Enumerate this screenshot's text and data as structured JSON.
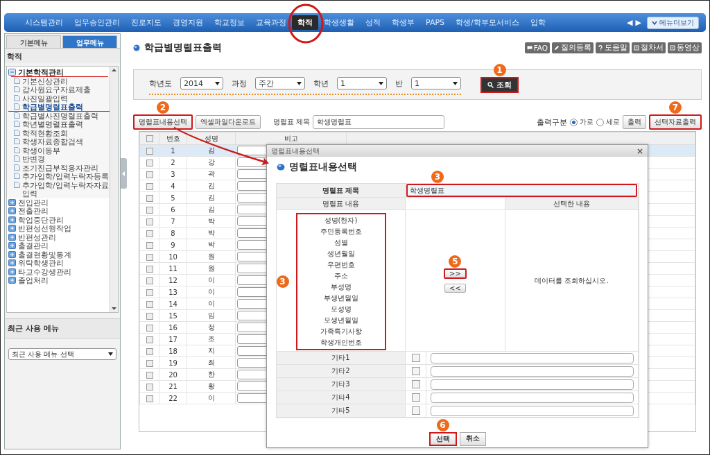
{
  "nav": {
    "items": [
      {
        "label": "시스템관리",
        "selected": false,
        "circled": false
      },
      {
        "label": "업무승인관리",
        "selected": false,
        "circled": false
      },
      {
        "label": "진로지도",
        "selected": false,
        "circled": false
      },
      {
        "label": "경영지원",
        "selected": false,
        "circled": false
      },
      {
        "label": "학교정보",
        "selected": false,
        "circled": false
      },
      {
        "label": "교육과정",
        "selected": false,
        "circled": false
      },
      {
        "label": "학적",
        "selected": true,
        "circled": true
      },
      {
        "label": "학생생활",
        "selected": false,
        "circled": false
      },
      {
        "label": "성적",
        "selected": false,
        "circled": false
      },
      {
        "label": "학생부",
        "selected": false,
        "circled": false
      },
      {
        "label": "PAPS",
        "selected": false,
        "circled": false
      },
      {
        "label": "학생/학부모서비스",
        "selected": false,
        "circled": false
      },
      {
        "label": "입학",
        "selected": false,
        "circled": false
      }
    ],
    "prev": "◀",
    "next": "▶",
    "more_button": "메뉴더보기"
  },
  "sidebar": {
    "tabs": [
      {
        "label": "기본메뉴",
        "selected": false
      },
      {
        "label": "업무메뉴",
        "selected": true
      }
    ],
    "heading": "학적",
    "tree": [
      {
        "label": "기본학적관리",
        "expanded": true,
        "underlined": true,
        "children": [
          {
            "label": "기본신상관리",
            "selected": false,
            "underlined": false
          },
          {
            "label": "감사원요구자료제출",
            "selected": false,
            "underlined": false
          },
          {
            "label": "사진일괄입력",
            "selected": false,
            "underlined": false
          },
          {
            "label": "학급별명렬표출력",
            "selected": true,
            "underlined": true
          },
          {
            "label": "학급별사진명렬표출력",
            "selected": false,
            "underlined": false
          },
          {
            "label": "학년별명렬표출력",
            "selected": false,
            "underlined": false
          },
          {
            "label": "학적현황조회",
            "selected": false,
            "underlined": false
          },
          {
            "label": "학생자료종합검색",
            "selected": false,
            "underlined": false
          },
          {
            "label": "학생이동부",
            "selected": false,
            "underlined": false
          },
          {
            "label": "반변경",
            "selected": false,
            "underlined": false
          },
          {
            "label": "조기진급부적응자관리",
            "selected": false,
            "underlined": false
          },
          {
            "label": "추가입학/입력누락자등록",
            "selected": false,
            "underlined": false
          },
          {
            "label": "추가입학/입력누락자자료입력",
            "selected": false,
            "underlined": false
          }
        ]
      },
      {
        "label": "전입관리",
        "expanded": false,
        "underlined": false
      },
      {
        "label": "전출관리",
        "expanded": false,
        "underlined": false
      },
      {
        "label": "학업중단관리",
        "expanded": false,
        "underlined": false
      },
      {
        "label": "반편성선행작업",
        "expanded": false,
        "underlined": false
      },
      {
        "label": "반편성관리",
        "expanded": false,
        "underlined": false
      },
      {
        "label": "출결관리",
        "expanded": false,
        "underlined": false
      },
      {
        "label": "출결현황및통계",
        "expanded": false,
        "underlined": false
      },
      {
        "label": "위탁학생관리",
        "expanded": false,
        "underlined": false
      },
      {
        "label": "타교수강생관리",
        "expanded": false,
        "underlined": false
      },
      {
        "label": "졸업처리",
        "expanded": false,
        "underlined": false
      }
    ],
    "recent_heading": "최근 사용 메뉴",
    "recent_select": "최근 사용 메뉴 선택"
  },
  "page": {
    "title": "학급별명렬표출력",
    "help_buttons": [
      {
        "kind": "faq",
        "label": "FAQ"
      },
      {
        "kind": "pencil",
        "label": "질의등록"
      },
      {
        "kind": "question",
        "label": "도움말"
      },
      {
        "kind": "doc",
        "label": "절차서"
      },
      {
        "kind": "doc",
        "label": "동영상"
      }
    ]
  },
  "filters": {
    "fields": [
      {
        "label": "학년도",
        "value": "2014"
      },
      {
        "label": "과정",
        "value": "주간"
      },
      {
        "label": "학년",
        "value": "1"
      },
      {
        "label": "반",
        "value": "1"
      }
    ],
    "search_button": {
      "label": "조회",
      "highlighted": true,
      "badge": "1"
    }
  },
  "toolbar": {
    "content_button": {
      "label": "명렬표내용선택",
      "highlighted": true,
      "badge": "2"
    },
    "excel_button": {
      "label": "엑셀파일다운로드",
      "highlighted": false
    },
    "title_label": "명렬표 제목",
    "title_value": "학생명렬표",
    "output_label": "출력구분",
    "output_options": [
      {
        "label": "가로",
        "selected": true
      },
      {
        "label": "세로",
        "selected": false
      }
    ],
    "print_button": {
      "label": "출력",
      "highlighted": false
    },
    "selected_print_button": {
      "label": "선택자료출력",
      "highlighted": true,
      "badge": "7"
    }
  },
  "table": {
    "all_checked": false,
    "columns": [
      "번호",
      "성명",
      "비고"
    ],
    "rows": [
      {
        "number": "1",
        "name": "김",
        "checked": false,
        "selected": true
      },
      {
        "number": "2",
        "name": "강",
        "checked": false,
        "selected": false
      },
      {
        "number": "3",
        "name": "곽",
        "checked": false,
        "selected": false
      },
      {
        "number": "4",
        "name": "김",
        "checked": false,
        "selected": false
      },
      {
        "number": "5",
        "name": "김",
        "checked": false,
        "selected": false
      },
      {
        "number": "6",
        "name": "김",
        "checked": false,
        "selected": false
      },
      {
        "number": "7",
        "name": "박",
        "checked": false,
        "selected": false
      },
      {
        "number": "8",
        "name": "박",
        "checked": false,
        "selected": false
      },
      {
        "number": "9",
        "name": "박",
        "checked": false,
        "selected": false
      },
      {
        "number": "10",
        "name": "원",
        "checked": false,
        "selected": false
      },
      {
        "number": "11",
        "name": "원",
        "checked": false,
        "selected": false
      },
      {
        "number": "12",
        "name": "이",
        "checked": false,
        "selected": false
      },
      {
        "number": "13",
        "name": "이",
        "checked": false,
        "selected": false
      },
      {
        "number": "14",
        "name": "이",
        "checked": false,
        "selected": false
      },
      {
        "number": "15",
        "name": "임",
        "checked": false,
        "selected": false
      },
      {
        "number": "16",
        "name": "정",
        "checked": false,
        "selected": false
      },
      {
        "number": "17",
        "name": "조",
        "checked": false,
        "selected": false
      },
      {
        "number": "18",
        "name": "지",
        "checked": false,
        "selected": false
      },
      {
        "number": "19",
        "name": "최",
        "checked": false,
        "selected": false
      },
      {
        "number": "20",
        "name": "한",
        "checked": false,
        "selected": false
      },
      {
        "number": "21",
        "name": "황",
        "checked": false,
        "selected": false
      },
      {
        "number": "22",
        "name": "이",
        "checked": false,
        "selected": false
      }
    ]
  },
  "dialog": {
    "window_title": "명렬표내용선택",
    "close": "×",
    "heading": "명렬표내용선택",
    "title_label": "명렬표 제목",
    "title_value": "학생명렬표",
    "title_highlighted": true,
    "title_badge": "3",
    "content_header": "명렬표 내용",
    "selected_header": "선택한 내용",
    "content_list": {
      "highlighted": true,
      "badge": "3",
      "items": [
        "성명(한자)",
        "주민등록번호",
        "성별",
        "생년월일",
        "우편번호",
        "주소",
        "부성명",
        "부생년월일",
        "모성명",
        "모생년월일",
        "가족특기사항",
        "학생개인번호"
      ]
    },
    "add_button": {
      "label": ">>",
      "highlighted": true,
      "badge": "5"
    },
    "remove_button": {
      "label": "<<",
      "highlighted": false
    },
    "empty_message": "데이터를 조회하십시오.",
    "extra_rows": [
      {
        "label": "기타1",
        "checked": false
      },
      {
        "label": "기타2",
        "checked": false
      },
      {
        "label": "기타3",
        "checked": false
      },
      {
        "label": "기타4",
        "checked": false
      },
      {
        "label": "기타5",
        "checked": false
      }
    ],
    "ok_button": {
      "label": "선택",
      "highlighted": true,
      "badge": "6"
    },
    "cancel_button": {
      "label": "취소",
      "highlighted": false
    }
  }
}
